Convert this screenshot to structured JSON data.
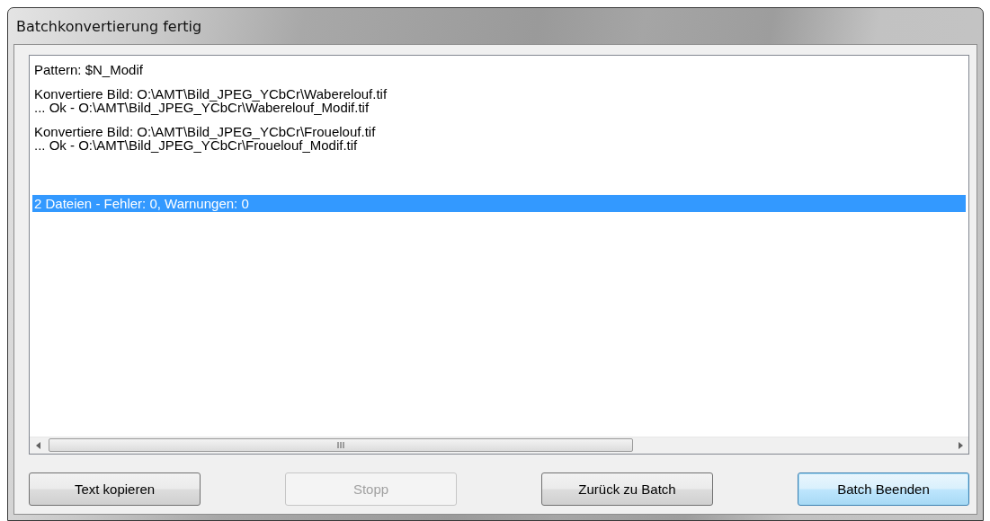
{
  "window": {
    "title": "Batchkonvertierung fertig"
  },
  "log": {
    "groups": [
      {
        "kind": "log",
        "lines": [
          {
            "text": "Pattern: $N_Modif",
            "selected": false
          }
        ]
      },
      {
        "kind": "log",
        "lines": [
          {
            "text": "Konvertiere Bild: O:\\AMT\\Bild_JPEG_YCbCr\\Waberelouf.tif",
            "selected": false
          },
          {
            "text": "... Ok - O:\\AMT\\Bild_JPEG_YCbCr\\Waberelouf_Modif.tif",
            "selected": false
          }
        ]
      },
      {
        "kind": "log",
        "lines": [
          {
            "text": "Konvertiere Bild: O:\\AMT\\Bild_JPEG_YCbCr\\Frouelouf.tif",
            "selected": false
          },
          {
            "text": "... Ok - O:\\AMT\\Bild_JPEG_YCbCr\\Frouelouf_Modif.tif",
            "selected": false
          }
        ]
      },
      {
        "kind": "summary",
        "lines": [
          {
            "text": "2 Dateien - Fehler: 0, Warnungen: 0",
            "selected": true
          }
        ]
      }
    ]
  },
  "buttons": [
    {
      "label": "Text kopieren",
      "disabled": false,
      "focused": false
    },
    {
      "label": "Stopp",
      "disabled": true,
      "focused": false
    },
    {
      "label": "Zurück zu Batch",
      "disabled": false,
      "focused": false
    },
    {
      "label": "Batch Beenden",
      "disabled": false,
      "focused": true
    }
  ]
}
